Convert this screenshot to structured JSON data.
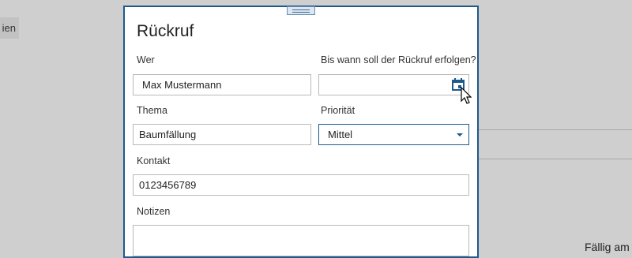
{
  "background": {
    "tab_label": "ien",
    "bottom_text": "Fällig am"
  },
  "dialog": {
    "title": "Rückruf",
    "fields": {
      "wer": {
        "label": "Wer",
        "value": "Max Mustermann"
      },
      "bis_wann": {
        "label": "Bis wann soll der Rückruf erfolgen?",
        "value": "",
        "icon": "calendar-icon"
      },
      "thema": {
        "label": "Thema",
        "value": "Baumfällung"
      },
      "prioritaet": {
        "label": "Priorität",
        "value": "Mittel",
        "icon": "chevron-down-icon"
      },
      "kontakt": {
        "label": "Kontakt",
        "value": "0123456789"
      },
      "notizen": {
        "label": "Notizen",
        "value": ""
      }
    }
  },
  "colors": {
    "accent": "#1e5a8c",
    "field_border": "#b9b9b9",
    "backdrop": "#cfcfcf"
  }
}
